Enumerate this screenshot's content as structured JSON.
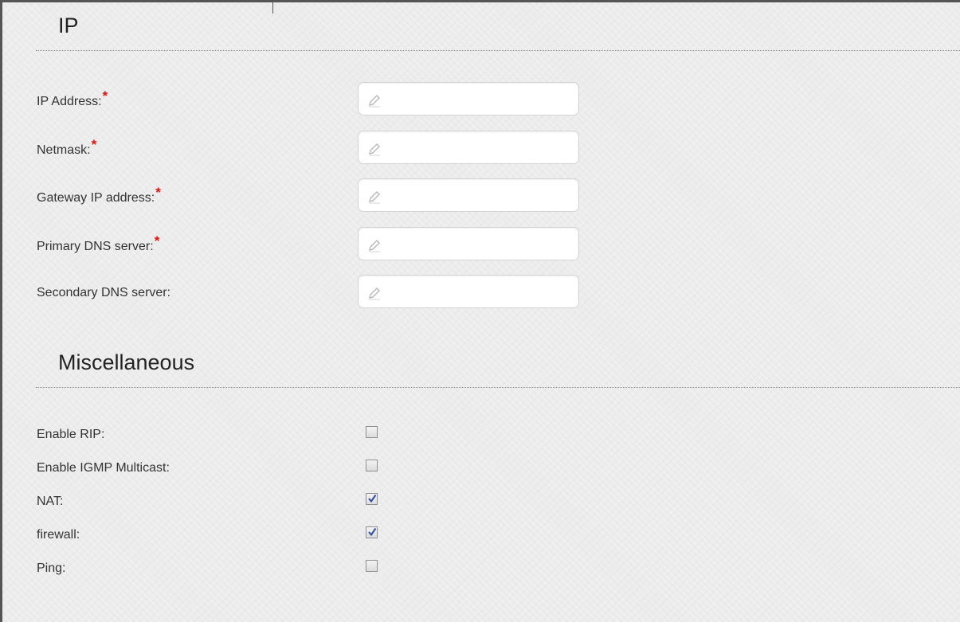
{
  "ip_section": {
    "title": "IP",
    "fields": [
      {
        "label": "IP Address:",
        "required": true,
        "value": ""
      },
      {
        "label": "Netmask:",
        "required": true,
        "value": ""
      },
      {
        "label": "Gateway IP address:",
        "required": true,
        "value": ""
      },
      {
        "label": "Primary DNS server:",
        "required": true,
        "value": ""
      },
      {
        "label": "Secondary DNS server:",
        "required": false,
        "value": ""
      }
    ],
    "required_marker": "*"
  },
  "misc_section": {
    "title": "Miscellaneous",
    "options": [
      {
        "label": "Enable RIP:",
        "checked": false
      },
      {
        "label": "Enable IGMP Multicast:",
        "checked": false
      },
      {
        "label": "NAT:",
        "checked": true
      },
      {
        "label": "firewall:",
        "checked": true
      },
      {
        "label": "Ping:",
        "checked": false
      }
    ]
  },
  "icons": {
    "field_icon": "pencil-icon",
    "check_icon": "checkmark-icon"
  },
  "colors": {
    "required_marker": "#e0120f",
    "checkmark": "#2b4fa8",
    "divider": "#8a8a8a"
  }
}
